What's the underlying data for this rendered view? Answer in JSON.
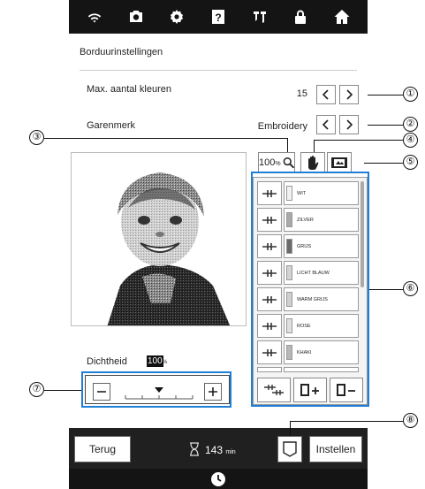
{
  "topbar": {
    "icons": [
      "wifi-icon",
      "camera-icon",
      "settings-icon",
      "help-icon",
      "needle-icon",
      "lock-icon",
      "home-icon"
    ]
  },
  "screen": {
    "title": "Borduurinstellingen",
    "max_colors": {
      "label": "Max. aantal kleuren",
      "value": "15"
    },
    "thread_brand": {
      "label": "Garenmerk",
      "value": "Embroidery"
    },
    "zoom": {
      "value": "100",
      "unit": "%"
    },
    "colors": [
      {
        "name": "WIT",
        "swatch": "#f2f2f2"
      },
      {
        "name": "ZILVER",
        "swatch": "#a9a9a9"
      },
      {
        "name": "GRIJS",
        "swatch": "#6b6b6b"
      },
      {
        "name": "LICHT BLAUW",
        "swatch": "#d3d3d3"
      },
      {
        "name": "WARM GRIJS",
        "swatch": "#cfcfcf"
      },
      {
        "name": "ROSE",
        "swatch": "#e0e0e0"
      },
      {
        "name": "KHAKI",
        "swatch": "#b7b7b7"
      }
    ],
    "density": {
      "label": "Dichtheid",
      "value": "100",
      "unit": "%",
      "level": 0.5
    }
  },
  "bottombar": {
    "back_label": "Terug",
    "time_value": "143",
    "time_unit": "min",
    "set_label": "Instellen"
  },
  "callouts": [
    "①",
    "②",
    "③",
    "④",
    "⑤",
    "⑥",
    "⑦",
    "⑧"
  ],
  "colors": {
    "highlight": "#1f7fd6",
    "bar": "#141414"
  }
}
